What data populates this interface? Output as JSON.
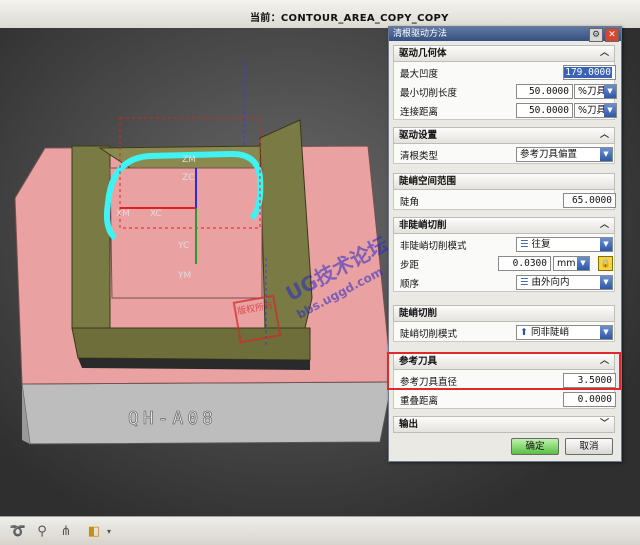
{
  "header": {
    "title": "当前：CONTOUR_AREA_COPY_COPY"
  },
  "viewport": {
    "axis_labels": [
      "ZM",
      "ZC",
      "XM",
      "XC",
      "YC",
      "YM"
    ],
    "part_label": "QH-A08"
  },
  "watermark": {
    "text": "UG技术论坛",
    "url": "bbs.uggd.com",
    "stamp": "版权所有"
  },
  "dialog": {
    "title": "清根驱动方法",
    "sections": {
      "geometry": {
        "title": "驱动几何体",
        "max_concavity_label": "最大凹度",
        "max_concavity_value": "179.0000",
        "min_cut_length_label": "最小切削长度",
        "min_cut_length_value": "50.0000",
        "min_cut_length_unit": "%刀具",
        "connect_distance_label": "连接距离",
        "connect_distance_value": "50.0000",
        "connect_distance_unit": "%刀具"
      },
      "drive_settings": {
        "title": "驱动设置",
        "type_label": "清根类型",
        "type_value": "参考刀具偏置"
      },
      "steep_space": {
        "title": "陡峭空间范围",
        "angle_label": "陡角",
        "angle_value": "65.0000"
      },
      "non_steep": {
        "title": "非陡峭切削",
        "mode_label": "非陡峭切削模式",
        "mode_value": "往复",
        "stepover_label": "步距",
        "stepover_value": "0.0300",
        "stepover_unit": "mm",
        "order_label": "顺序",
        "order_value": "由外向内"
      },
      "steep": {
        "title": "陡峭切削",
        "mode_label": "陡峭切削模式",
        "mode_value": "同非陡峭"
      },
      "ref_tool": {
        "title": "参考刀具",
        "diameter_label": "参考刀具直径",
        "diameter_value": "3.5000",
        "overlap_label": "重叠距离",
        "overlap_value": "0.0000"
      },
      "output": {
        "title": "输出"
      }
    },
    "ok_label": "确定",
    "cancel_label": "取消"
  },
  "colors": {
    "part_body": "#e9a1a1",
    "part_walls": "#6e6e3a",
    "highlight": "#e02a2a",
    "toolpath": "#41f2f2"
  }
}
